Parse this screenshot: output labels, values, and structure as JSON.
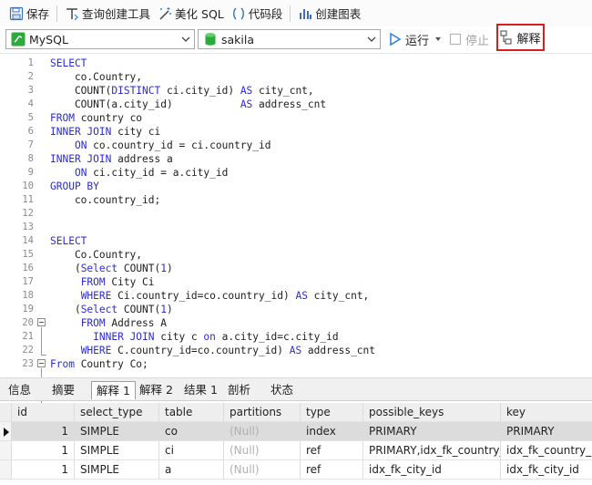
{
  "toolbar": {
    "save": "保存",
    "query_builder": "查询创建工具",
    "beautify_sql": "美化 SQL",
    "code_snippet": "代码段",
    "create_chart": "创建图表"
  },
  "connection": {
    "db_type": "MySQL",
    "schema": "sakila",
    "run": "运行",
    "stop": "停止",
    "explain": "解释"
  },
  "editor": {
    "lines": [
      {
        "n": "1",
        "text": [
          {
            "t": "SELECT",
            "k": true
          }
        ]
      },
      {
        "n": "2",
        "text": [
          {
            "t": "    co.Country,"
          }
        ]
      },
      {
        "n": "3",
        "text": [
          {
            "t": "    COUNT("
          },
          {
            "t": "DISTINCT",
            "k": true
          },
          {
            "t": " ci.city_id) "
          },
          {
            "t": "AS",
            "k": true
          },
          {
            "t": " city_cnt,"
          }
        ]
      },
      {
        "n": "4",
        "text": [
          {
            "t": "    COUNT(a.city_id)           "
          },
          {
            "t": "AS",
            "k": true
          },
          {
            "t": " address_cnt"
          }
        ]
      },
      {
        "n": "5",
        "text": [
          {
            "t": "FROM",
            "k": true
          },
          {
            "t": " country co"
          }
        ]
      },
      {
        "n": "6",
        "text": [
          {
            "t": "INNER JOIN",
            "k": true
          },
          {
            "t": " city ci"
          }
        ]
      },
      {
        "n": "7",
        "text": [
          {
            "t": "    "
          },
          {
            "t": "ON",
            "k": true
          },
          {
            "t": " co.country_id = ci.country_id"
          }
        ]
      },
      {
        "n": "8",
        "text": [
          {
            "t": "INNER JOIN",
            "k": true
          },
          {
            "t": " address a"
          }
        ]
      },
      {
        "n": "9",
        "text": [
          {
            "t": "    "
          },
          {
            "t": "ON",
            "k": true
          },
          {
            "t": " ci.city_id = a.city_id"
          }
        ]
      },
      {
        "n": "10",
        "text": [
          {
            "t": "GROUP BY",
            "k": true
          }
        ]
      },
      {
        "n": "11",
        "text": [
          {
            "t": "    co.country_id;"
          }
        ]
      },
      {
        "n": "12",
        "text": []
      },
      {
        "n": "13",
        "text": []
      },
      {
        "n": "14",
        "text": [
          {
            "t": "SELECT",
            "k": true
          }
        ]
      },
      {
        "n": "15",
        "text": [
          {
            "t": "    Co.Country,"
          }
        ]
      },
      {
        "n": "16",
        "text": [
          {
            "t": "    ("
          },
          {
            "t": "Select",
            "k": true
          },
          {
            "t": " COUNT("
          },
          {
            "t": "1",
            "k": true
          },
          {
            "t": ")"
          }
        ]
      },
      {
        "n": "17",
        "text": [
          {
            "t": "     "
          },
          {
            "t": "FROM",
            "k": true
          },
          {
            "t": " City Ci"
          }
        ]
      },
      {
        "n": "18",
        "text": [
          {
            "t": "     "
          },
          {
            "t": "WHERE",
            "k": true
          },
          {
            "t": " Ci.country_id=co.country_id) "
          },
          {
            "t": "AS",
            "k": true
          },
          {
            "t": " city_cnt,"
          }
        ]
      },
      {
        "n": "19",
        "text": [
          {
            "t": "    ("
          },
          {
            "t": "Select",
            "k": true
          },
          {
            "t": " COUNT("
          },
          {
            "t": "1",
            "k": true
          },
          {
            "t": ")"
          }
        ]
      },
      {
        "n": "20",
        "text": [
          {
            "t": "     "
          },
          {
            "t": "FROM",
            "k": true
          },
          {
            "t": " Address A"
          }
        ]
      },
      {
        "n": "21",
        "text": [
          {
            "t": "       "
          },
          {
            "t": "INNER JOIN",
            "k": true
          },
          {
            "t": " city c "
          },
          {
            "t": "on",
            "k": true
          },
          {
            "t": " a.city_id=c.city_id"
          }
        ]
      },
      {
        "n": "22",
        "text": [
          {
            "t": "     "
          },
          {
            "t": "WHERE",
            "k": true
          },
          {
            "t": " C.country_id=co.country_id) "
          },
          {
            "t": "AS",
            "k": true
          },
          {
            "t": " address_cnt"
          }
        ]
      },
      {
        "n": "23",
        "text": [
          {
            "t": "From",
            "k": true
          },
          {
            "t": " Country Co;"
          }
        ]
      }
    ]
  },
  "result_tabs": [
    "信息",
    "摘要",
    "解释 1",
    "解释 2",
    "结果 1",
    "剖析",
    "状态"
  ],
  "grid": {
    "columns": [
      "id",
      "select_type",
      "table",
      "partitions",
      "type",
      "possible_keys",
      "key"
    ],
    "rows": [
      [
        "1",
        "SIMPLE",
        "co",
        "(Null)",
        "index",
        "PRIMARY",
        "PRIMARY"
      ],
      [
        "1",
        "SIMPLE",
        "ci",
        "(Null)",
        "ref",
        "PRIMARY,idx_fk_country_",
        "idx_fk_country_id"
      ],
      [
        "1",
        "SIMPLE",
        "a",
        "(Null)",
        "ref",
        "idx_fk_city_id",
        "idx_fk_city_id"
      ]
    ]
  },
  "colors": {
    "keyword": "#2b2bd6",
    "explain_highlight": "#d81e1e",
    "run_icon": "#2f7fd8",
    "db_icon": "#2eaa3c"
  }
}
